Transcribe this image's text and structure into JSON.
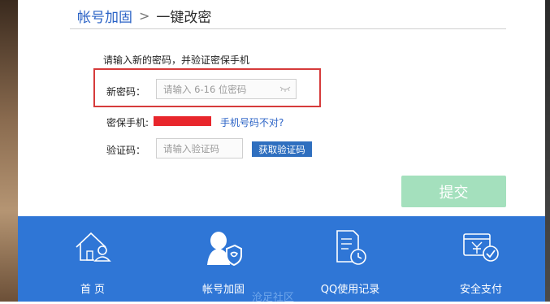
{
  "breadcrumb": {
    "parent": "帐号加固",
    "separator": ">",
    "current": "一键改密"
  },
  "form": {
    "instruction": "请输入新的密码，并验证密保手机",
    "new_password_label": "新密码：",
    "new_password_placeholder": "请输入 6-16 位密码",
    "phone_label": "密保手机:",
    "phone_wrong_link": "手机号码不对?",
    "code_label": "验证码：",
    "code_placeholder": "请输入验证码",
    "get_code_button": "获取验证码",
    "submit_button": "提交"
  },
  "footer": {
    "items": [
      {
        "label": "首 页",
        "icon": "home-user-icon"
      },
      {
        "label": "帐号加固",
        "icon": "account-shield-icon"
      },
      {
        "label": "QQ使用记录",
        "icon": "usage-record-icon"
      },
      {
        "label": "安全支付",
        "icon": "secure-payment-icon"
      }
    ]
  },
  "watermark": "沧足社区",
  "colors": {
    "accent_blue": "#2f76d6",
    "link_blue": "#2b63c6",
    "submit_disabled": "#a4e0bd",
    "highlight_red": "#d63b3b",
    "phone_mask_red": "#e8262c"
  }
}
